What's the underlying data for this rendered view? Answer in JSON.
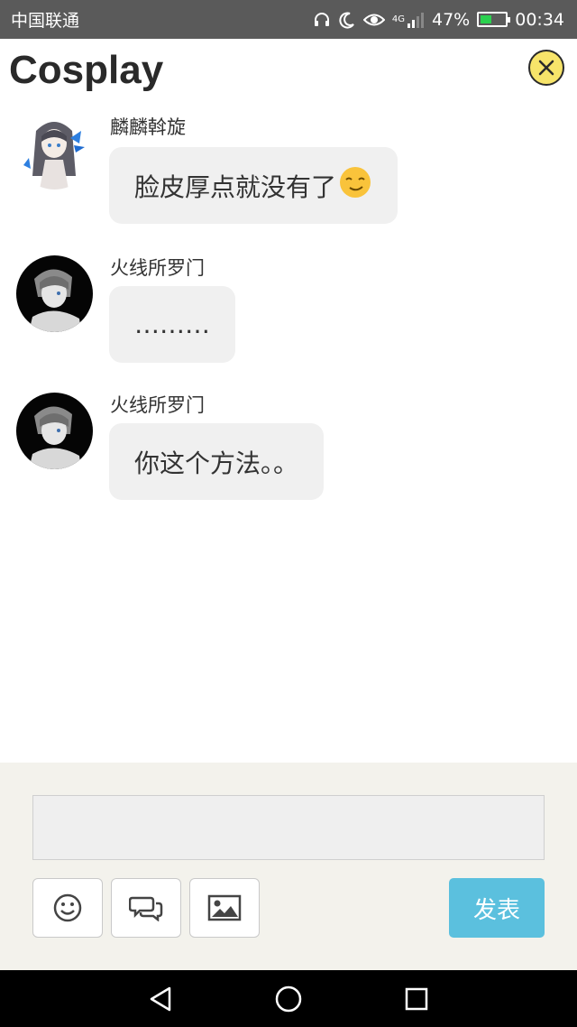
{
  "status_bar": {
    "carrier": "中国联通",
    "network": "4G",
    "battery": "47%",
    "battery_level": 0.47,
    "time": "00:34",
    "icons": [
      "headphones-icon",
      "moon-icon",
      "eye-icon",
      "signal-icon",
      "battery-icon"
    ]
  },
  "header": {
    "title": "Cosplay",
    "close_icon": "close-icon",
    "close_color": "#f7e46a"
  },
  "messages": [
    {
      "sender": "麟麟斡旋",
      "text": "脸皮厚点就没有了",
      "emoji": "smirk-emoji",
      "avatar": "avatar-anime-girl"
    },
    {
      "sender": "火线所罗门",
      "text": "………",
      "avatar": "avatar-anime-boy"
    },
    {
      "sender": "火线所罗门",
      "text": "你这个方法。。",
      "avatar": "avatar-anime-boy"
    }
  ],
  "composer": {
    "input_value": "",
    "tools": [
      "smiley-icon",
      "chat-bubbles-icon",
      "image-icon"
    ],
    "send_label": "发表",
    "send_color": "#5bc0de"
  },
  "nav_bar": {
    "buttons": [
      "back-icon",
      "home-icon",
      "recents-icon"
    ]
  }
}
